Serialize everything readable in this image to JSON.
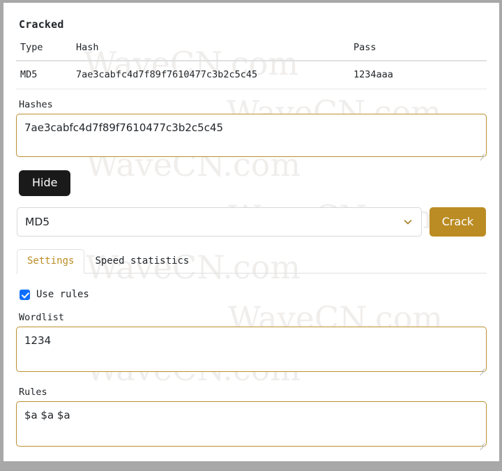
{
  "cracked": {
    "heading": "Cracked",
    "columns": [
      "Type",
      "Hash",
      "Pass"
    ],
    "rows": [
      {
        "type": "MD5",
        "hash": "7ae3cabfc4d7f89f7610477c3b2c5c45",
        "pass": "1234aaa"
      }
    ]
  },
  "hashes": {
    "label": "Hashes",
    "value": "7ae3cabfc4d7f89f7610477c3b2c5c45",
    "placeholder": ""
  },
  "hide_button": {
    "label": "Hide"
  },
  "algorithm": {
    "selected": "MD5",
    "options": [
      "MD5"
    ],
    "chevron_icon": "chevron-down-icon",
    "chevron_color": "#ab842c"
  },
  "crack_button": {
    "label": "Crack",
    "color": "#bb8c24"
  },
  "tabs": [
    {
      "label": "Settings",
      "active": true
    },
    {
      "label": "Speed statistics",
      "active": false
    }
  ],
  "use_rules": {
    "label": "Use rules",
    "checked": true,
    "color": "#0d6efd"
  },
  "wordlist": {
    "label": "Wordlist",
    "value": "1234",
    "placeholder": ""
  },
  "rules": {
    "label": "Rules",
    "value": "$a $a $a",
    "placeholder": ""
  },
  "watermark": {
    "text": "WaveCN.com",
    "color": "#f0eeec"
  },
  "theme": {
    "accent": "#bb8c24",
    "input_border": "#bb902f",
    "dark_button": "#1a1a1a",
    "frame": "#a8a8a8"
  }
}
